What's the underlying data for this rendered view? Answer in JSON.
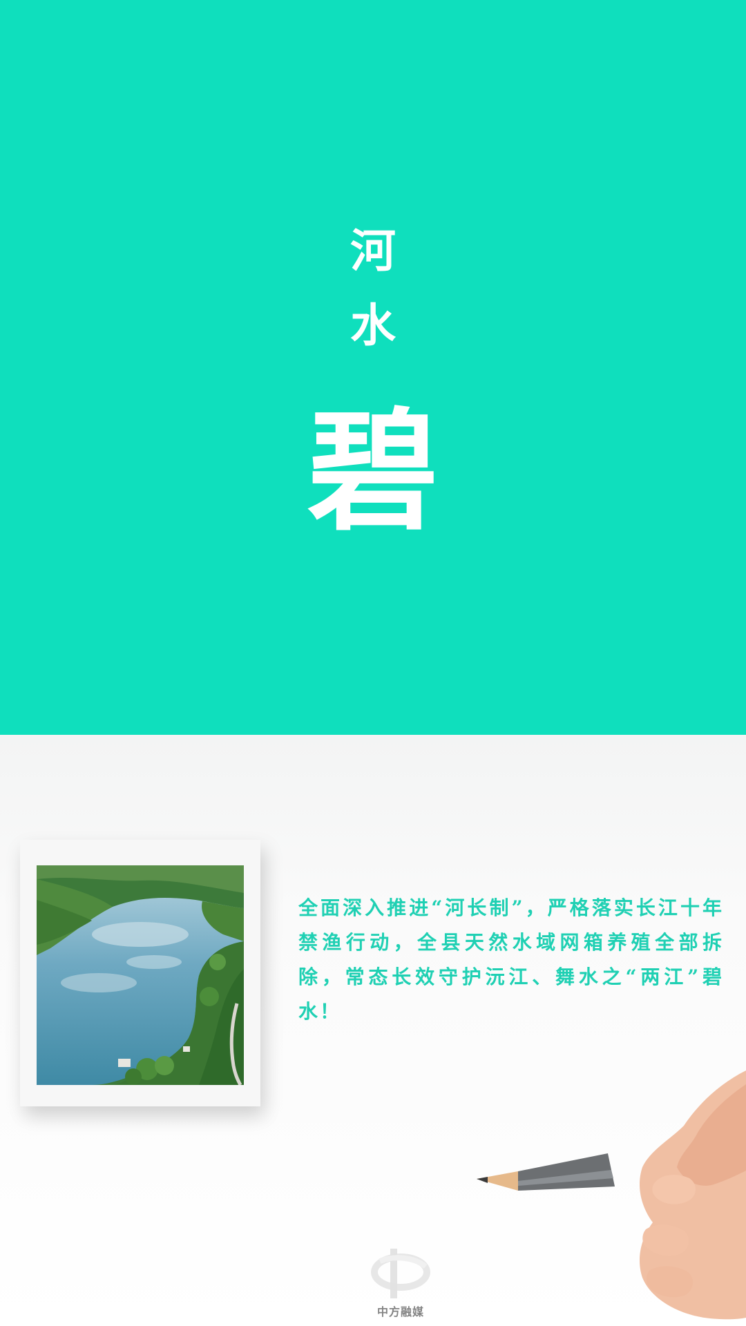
{
  "title": {
    "line1": "河",
    "line2": "水",
    "line3": "碧"
  },
  "caption": "全面深入推进“河长制”，严格落实长江十年禁渔行动，全县天然水域网箱养殖全部拆除，常态长效守护沅江、舞水之“两江”碧水！",
  "watermark": {
    "text": "中方融媒"
  },
  "colors": {
    "teal": "#0fdfbd",
    "caption": "#1fd0b3"
  }
}
